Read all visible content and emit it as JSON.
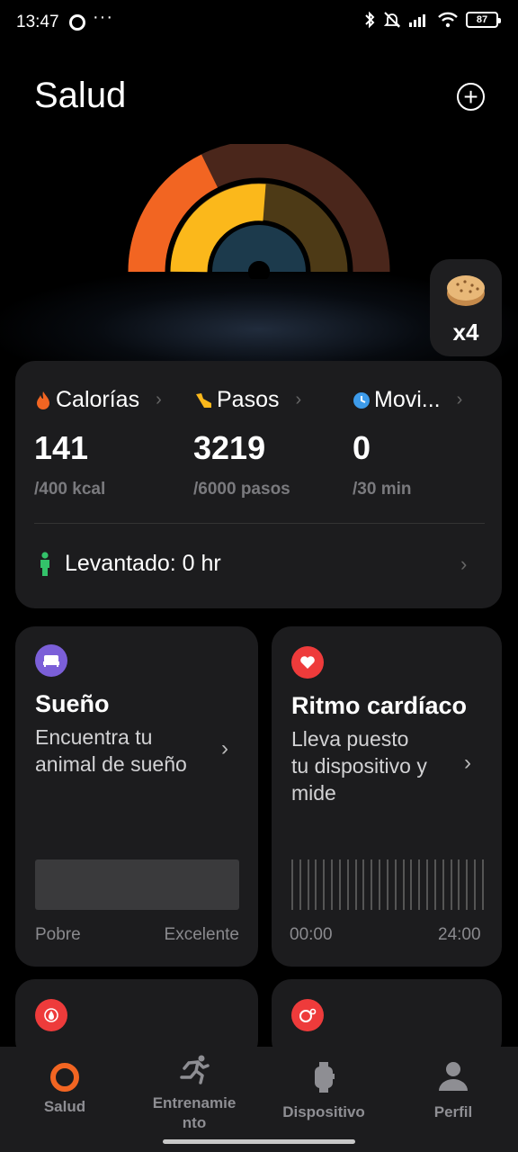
{
  "status_bar": {
    "time": "13:47",
    "dots": "···",
    "battery": "87"
  },
  "header": {
    "title": "Salud",
    "add_icon": "plus-circle-icon"
  },
  "achievement": {
    "icon": "cookie-icon",
    "count": "x4"
  },
  "activity": {
    "calories": {
      "label": "Calorías",
      "value": "141",
      "goal": "/400 kcal",
      "progress": 0.35,
      "color": "#f26522"
    },
    "steps": {
      "label": "Pasos",
      "value": "3219",
      "goal": "/6000 pasos",
      "progress": 0.54,
      "color": "#fbb81b"
    },
    "moving": {
      "label": "Movi...",
      "value": "0",
      "goal": "/30 min",
      "progress": 0.0,
      "color": "#3d9bea"
    },
    "standing": {
      "label": "Levantado: 0 hr"
    }
  },
  "sleep": {
    "title": "Sueño",
    "text_line1": "Encuentra tu",
    "text_line2": "animal de sueño",
    "low_label": "Pobre",
    "high_label": "Excelente",
    "color": "#7b5fd8"
  },
  "heart": {
    "title": "Ritmo cardíaco",
    "text_line1": "Lleva puesto",
    "text_line2": "tu dispositivo y",
    "text_line3": "mide",
    "start_label": "00:00",
    "end_label": "24:00",
    "color": "#ee3b3b"
  },
  "more_tiles": {
    "left_icon": "drop-icon",
    "right_icon": "spo2-icon"
  },
  "bottom_nav": {
    "items": [
      {
        "label": "Salud",
        "icon": "health-ring-icon",
        "active": true
      },
      {
        "label_line1": "Entrenamie",
        "label_line2": "nto",
        "icon": "runner-icon"
      },
      {
        "label": "Dispositivo",
        "icon": "watch-icon"
      },
      {
        "label": "Perfil",
        "icon": "person-icon"
      }
    ]
  }
}
